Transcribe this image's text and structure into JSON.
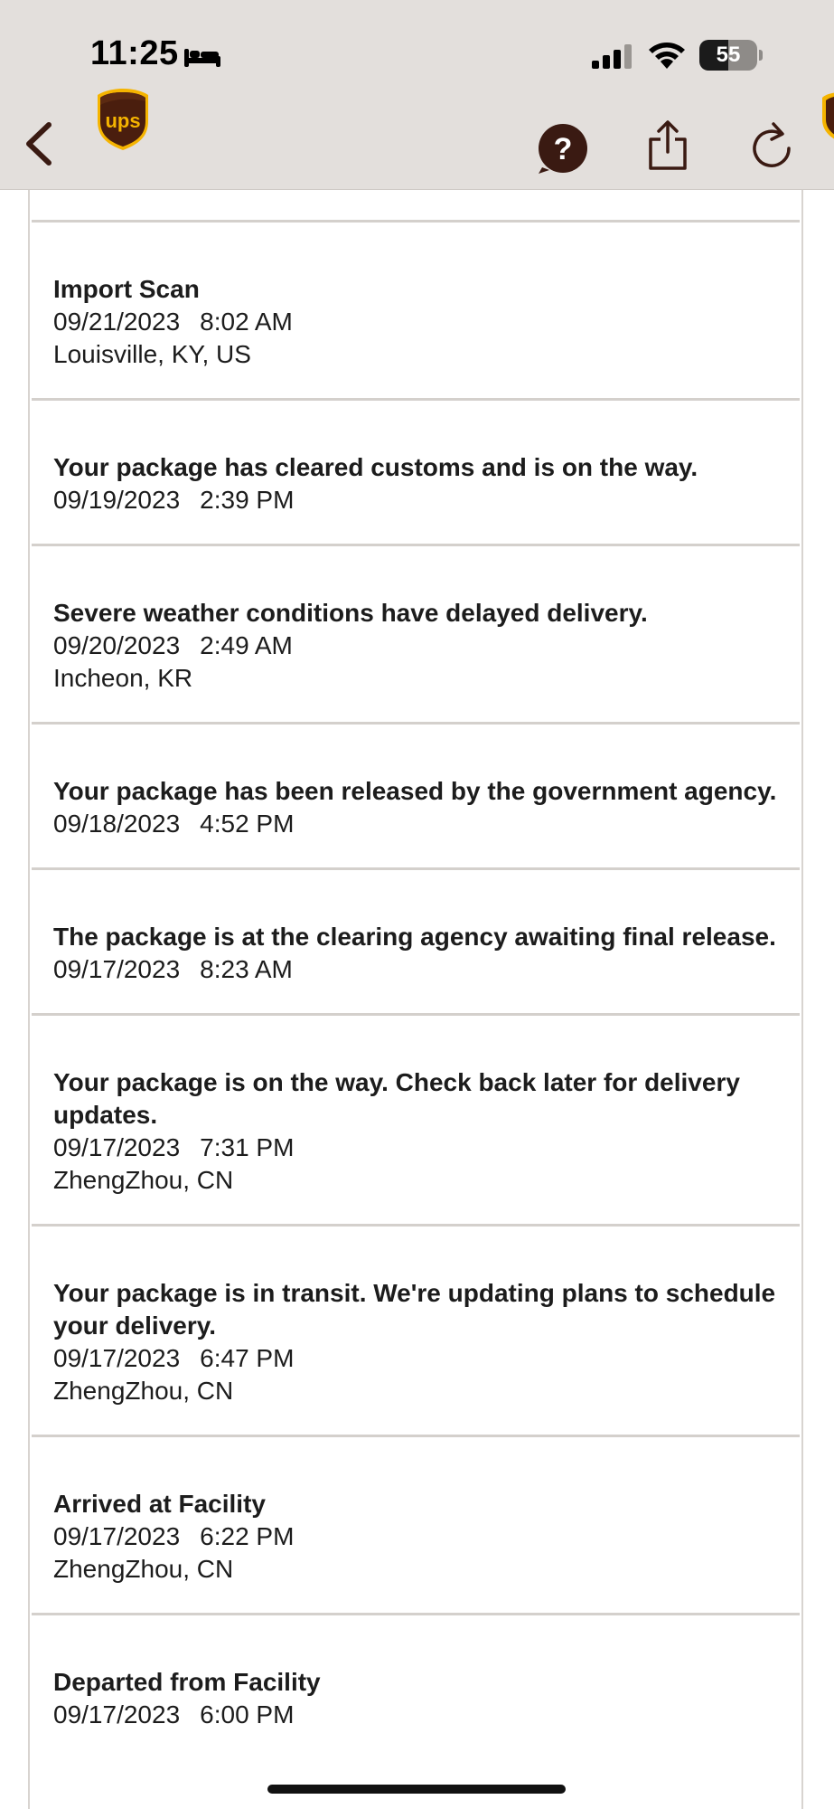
{
  "status_bar": {
    "time": "11:25",
    "battery_level": "55",
    "battery_fill_percent": 50
  },
  "nav": {
    "back_icon": "chevron-left-icon",
    "logo_icon": "ups-shield-logo",
    "help_icon": "question-circle-icon",
    "share_icon": "share-icon",
    "refresh_icon": "refresh-icon"
  },
  "colors": {
    "topbar_background": "#e3dfdc",
    "nav_icon": "#3a1a12",
    "ups_brown": "#4a1e0e",
    "ups_gold": "#f5b400",
    "divider": "#d4d0cc"
  },
  "events": [
    {
      "title": "Import Scan",
      "date": "09/21/2023",
      "time": "8:02 AM",
      "location": "Louisville, KY, US"
    },
    {
      "title": "Your package has cleared customs and is on the way.",
      "date": "09/19/2023",
      "time": "2:39 PM",
      "location": ""
    },
    {
      "title": "Severe weather conditions have delayed delivery.",
      "date": "09/20/2023",
      "time": "2:49 AM",
      "location": "Incheon, KR"
    },
    {
      "title": "Your package has been released by the government agency.",
      "date": "09/18/2023",
      "time": "4:52 PM",
      "location": ""
    },
    {
      "title": "The package is at the clearing agency awaiting final release.",
      "date": "09/17/2023",
      "time": "8:23 AM",
      "location": ""
    },
    {
      "title": "Your package is on the way. Check back later for delivery updates.",
      "date": "09/17/2023",
      "time": "7:31 PM",
      "location": "ZhengZhou, CN"
    },
    {
      "title": "Your package is in transit. We're updating plans to schedule your delivery.",
      "date": "09/17/2023",
      "time": "6:47 PM",
      "location": "ZhengZhou, CN"
    },
    {
      "title": "Arrived at Facility",
      "date": "09/17/2023",
      "time": "6:22 PM",
      "location": "ZhengZhou, CN"
    },
    {
      "title": "Departed from Facility",
      "date": "09/17/2023",
      "time": "6:00 PM",
      "location": ""
    }
  ]
}
